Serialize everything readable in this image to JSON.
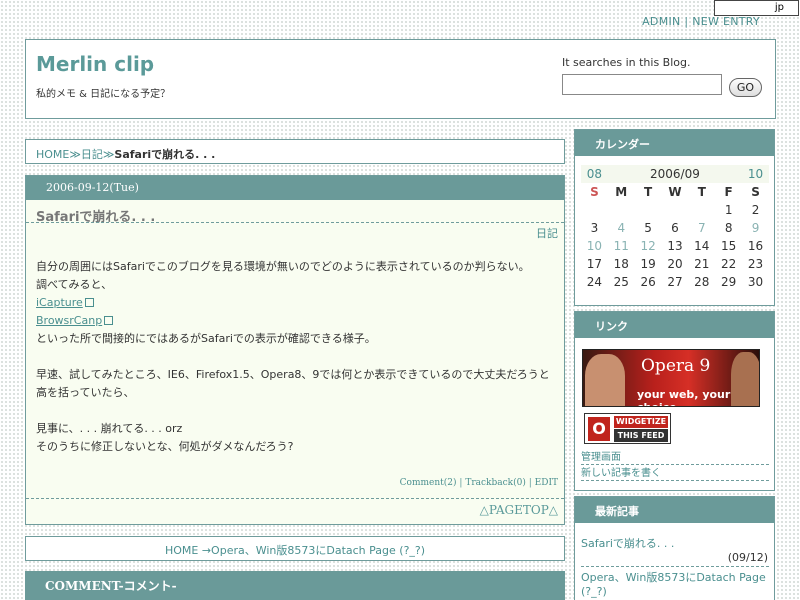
{
  "top_badge": "jp",
  "admin": {
    "admin": "ADMIN",
    "sep": "|",
    "new_entry": "NEW ENTRY"
  },
  "header": {
    "title": "Merlin clip",
    "description": "私的メモ & 日記になる予定？",
    "search_label": "It searches in this Blog.",
    "search_value": "",
    "go": "GO"
  },
  "breadcrumb": {
    "home": "HOME",
    "sep1": "≫",
    "category": "日記",
    "sep2": "≫",
    "current": "Safariで崩れる. . ."
  },
  "entry": {
    "date": "2006-09-12(Tue)",
    "title": "Safariで崩れる. . .",
    "category": "日記",
    "lines": [
      "自分の周囲にはSafariでこのブログを見る環境が無いのでどのように表示されているのか判らない。",
      "調べてみると、"
    ],
    "link1": "iCapture",
    "link2": "BrowsrCanp",
    "line_after_links": "といった所で間接的にではあるがSafariでの表示が確認できる様子。",
    "para2": [
      "早速、試してみたところ、IE6、Firefox1.5、Opera8、9では何とか表示できているので大丈夫だろうと",
      "高を括っていたら、"
    ],
    "para3": [
      "見事に、. . . 崩れてる. . . orz",
      "そのうちに修正しないとな、何処がダメなんだろう?"
    ],
    "comment": "Comment(2)",
    "sep": "|",
    "trackback": "Trackback(0)",
    "edit": "EDIT",
    "pagetop": "△PAGETOP△"
  },
  "nav": {
    "home": "HOME",
    "arrow": "→",
    "next": "Opera、Win版8573にDatach Page (?_?)"
  },
  "comment_section": {
    "title": "COMMENT-コメント-"
  },
  "sidebar": {
    "calendar": {
      "title": "カレンダー",
      "prev": "08",
      "month": "2006/09",
      "next": "10",
      "weekdays": [
        "S",
        "M",
        "T",
        "W",
        "T",
        "F",
        "S"
      ],
      "weeks": [
        [
          "",
          "",
          "",
          "",
          "",
          "1",
          "2"
        ],
        [
          "3",
          "4",
          "5",
          "6",
          "7",
          "8",
          "9"
        ],
        [
          "10",
          "11",
          "12",
          "13",
          "14",
          "15",
          "16"
        ],
        [
          "17",
          "18",
          "19",
          "20",
          "21",
          "22",
          "23"
        ],
        [
          "24",
          "25",
          "26",
          "27",
          "28",
          "29",
          "30"
        ]
      ]
    },
    "links": {
      "title": "リンク",
      "opera_banner_title": "Opera 9",
      "opera_banner_tag": "your web, your choice",
      "widgetize_o": "O",
      "widgetize_1": "WIDGETIZE",
      "widgetize_2": "THIS FEED",
      "items": [
        "管理画面",
        "新しい記事を書く"
      ]
    },
    "recent": {
      "title": "最新記事",
      "items": [
        {
          "title": "Safariで崩れる. . .",
          "date": "(09/12)"
        },
        {
          "title": "Opera、Win版8573にDatach Page (?_?)",
          "date": ""
        }
      ]
    }
  }
}
